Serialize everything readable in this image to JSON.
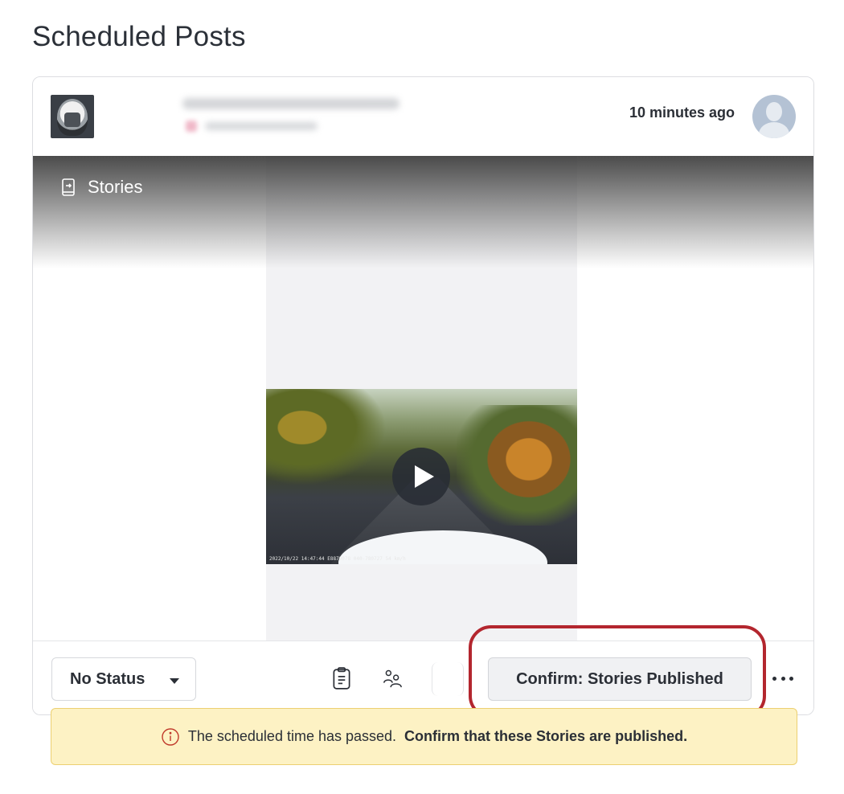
{
  "page": {
    "title": "Scheduled Posts"
  },
  "post": {
    "timestamp": "10 minutes ago",
    "media_type_label": "Stories",
    "video_overlay_text": "2022/10/22 14:47:44  E8879078 040-780727 54 km/h"
  },
  "footer": {
    "status_value": "No Status",
    "confirm_label": "Confirm: Stories Published"
  },
  "notice": {
    "text": "The scheduled time has passed.",
    "emphasis": "Confirm that these Stories are published."
  },
  "colors": {
    "highlight_ring": "#b3262e",
    "notice_bg": "#fdf2c4",
    "notice_icon": "#c0392b"
  },
  "icons": [
    "stories-icon",
    "play-icon",
    "notes-icon",
    "team-icon",
    "more-icon",
    "info-icon",
    "caret-down-icon"
  ]
}
